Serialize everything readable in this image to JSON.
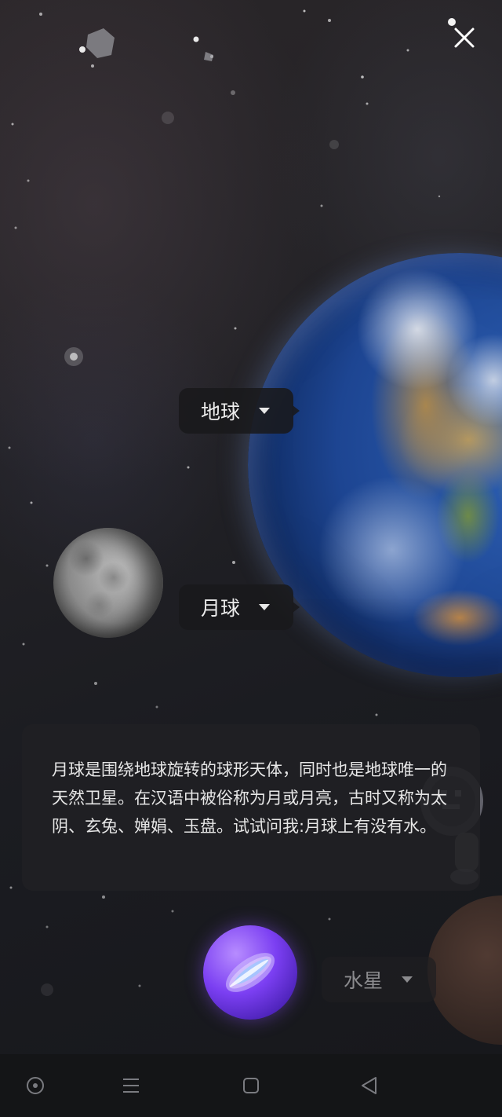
{
  "labels": {
    "earth": "地球",
    "moon": "月球",
    "mercury": "水星"
  },
  "info_card": {
    "text": "月球是围绕地球旋转的球形天体，同时也是地球唯一的天然卫星。在汉语中被俗称为月或月亮，古时又称为太阴、玄兔、婵娟、玉盘。试试问我:月球上有没有水。"
  },
  "icons": {
    "close": "close-icon",
    "caret": "caret-down-icon",
    "assistant": "assistant-orb-icon",
    "nav_home": "circle-dot-icon",
    "nav_menu": "menu-icon",
    "nav_recent": "square-icon",
    "nav_back": "triangle-back-icon"
  },
  "colors": {
    "label_bg": "#19191b",
    "card_bg": "#202023",
    "orb_accent": "#7b3ff2",
    "text": "#e6e6e6"
  }
}
